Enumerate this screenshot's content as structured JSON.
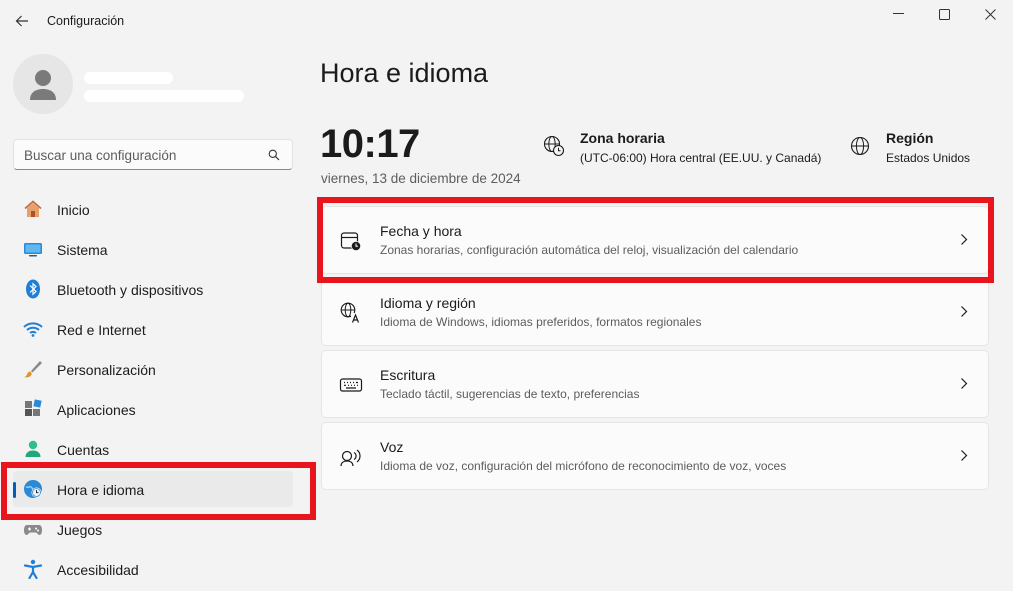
{
  "window": {
    "title": "Configuración",
    "controls": [
      "minimize-icon",
      "maximize-icon",
      "close-icon"
    ]
  },
  "sidebar": {
    "search_placeholder": "Buscar una configuración",
    "items": [
      {
        "label": "Inicio",
        "icon": "home-icon"
      },
      {
        "label": "Sistema",
        "icon": "system-icon"
      },
      {
        "label": "Bluetooth y dispositivos",
        "icon": "bluetooth-icon"
      },
      {
        "label": "Red e Internet",
        "icon": "wifi-icon"
      },
      {
        "label": "Personalización",
        "icon": "brush-icon"
      },
      {
        "label": "Aplicaciones",
        "icon": "apps-icon"
      },
      {
        "label": "Cuentas",
        "icon": "account-icon"
      },
      {
        "label": "Hora e idioma",
        "icon": "time-language-icon",
        "active": true
      },
      {
        "label": "Juegos",
        "icon": "gamepad-icon"
      },
      {
        "label": "Accesibilidad",
        "icon": "accessibility-icon"
      }
    ]
  },
  "main": {
    "title": "Hora e idioma",
    "clock": "10:17",
    "date": "viernes, 13 de diciembre de 2024",
    "timezone": {
      "title": "Zona horaria",
      "value": "(UTC-06:00) Hora central (EE.UU. y Canadá)"
    },
    "region": {
      "title": "Región",
      "value": "Estados Unidos"
    },
    "cards": [
      {
        "title": "Fecha y hora",
        "subtitle": "Zonas horarias, configuración automática del reloj, visualización del calendario",
        "icon": "calendar-clock-icon"
      },
      {
        "title": "Idioma y región",
        "subtitle": "Idioma de Windows, idiomas preferidos, formatos regionales",
        "icon": "language-icon"
      },
      {
        "title": "Escritura",
        "subtitle": "Teclado táctil, sugerencias de texto, preferencias",
        "icon": "keyboard-icon"
      },
      {
        "title": "Voz",
        "subtitle": "Idioma de voz, configuración del micrófono de reconocimiento de voz, voces",
        "icon": "speech-icon"
      }
    ]
  },
  "colors": {
    "accent": "#005fb8",
    "highlight_box": "#e8141e",
    "background": "#f3f3f3"
  }
}
